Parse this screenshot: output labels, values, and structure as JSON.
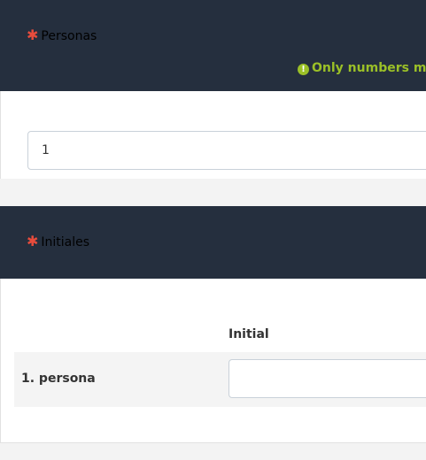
{
  "question1": {
    "required_mark": "✱",
    "title": "Personas",
    "validation_icon": "!",
    "validation_text": "Only numbers may",
    "input_value": "1"
  },
  "question2": {
    "required_mark": "✱",
    "title": "Initiales",
    "column_header": "Initial",
    "rows": [
      {
        "label": "1. persona",
        "value": ""
      }
    ]
  },
  "colors": {
    "header_bg": "#252f3e",
    "required": "#e74c3c",
    "validation": "#9bc027"
  }
}
